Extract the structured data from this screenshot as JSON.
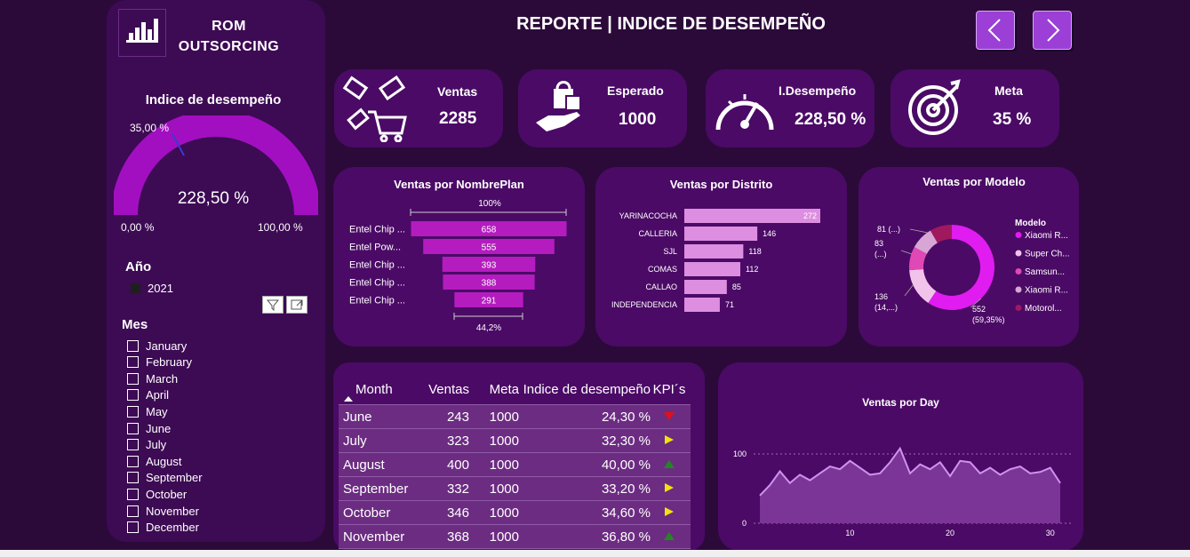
{
  "brand": {
    "line1": "ROM",
    "line2": "OUTSORCING"
  },
  "title": "REPORTE | INDICE DE DESEMPEÑO",
  "gauge": {
    "title": "Indice de desempeño",
    "value_label": "228,50 %",
    "min_label": "0,00 %",
    "max_label": "100,00 %",
    "target_label": "35,00 %",
    "fill_fraction": 1.0,
    "target_fraction": 0.35
  },
  "filters": {
    "year_title": "Año",
    "year_value": "2021",
    "month_title": "Mes",
    "months": [
      "January",
      "February",
      "March",
      "April",
      "May",
      "June",
      "July",
      "August",
      "September",
      "October",
      "November",
      "December"
    ]
  },
  "kpis": [
    {
      "label": "Ventas",
      "value": "2285",
      "icon": "sales-tags-cart-icon"
    },
    {
      "label": "Esperado",
      "value": "1000",
      "icon": "shopping-bag-hand-icon"
    },
    {
      "label": "I.Desempeño",
      "value": "228,50 %",
      "icon": "speedometer-icon"
    },
    {
      "label": "Meta",
      "value": "35 %",
      "icon": "target-icon"
    }
  ],
  "funnel": {
    "title": "Ventas por NombrePlan",
    "top_pct": "100%",
    "bottom_pct": "44,2%",
    "items": [
      {
        "label": "Entel Chip ...",
        "value": "658"
      },
      {
        "label": "Entel Pow...",
        "value": "555"
      },
      {
        "label": "Entel Chip ...",
        "value": "393"
      },
      {
        "label": "Entel Chip ...",
        "value": "388"
      },
      {
        "label": "Entel Chip ...",
        "value": "291"
      }
    ]
  },
  "district": {
    "title": "Ventas por Distrito",
    "items": [
      {
        "label": "YARINACOCHA",
        "value": "272"
      },
      {
        "label": "CALLERIA",
        "value": "146"
      },
      {
        "label": "SJL",
        "value": "118"
      },
      {
        "label": "COMAS",
        "value": "112"
      },
      {
        "label": "CALLAO",
        "value": "85"
      },
      {
        "label": "INDEPENDENCIA",
        "value": "71"
      }
    ]
  },
  "model": {
    "title": "Ventas por Modelo",
    "legend_title": "Modelo",
    "legend": [
      {
        "name": "Xiaomi R...",
        "color": "#e01cf0"
      },
      {
        "name": "Super Ch...",
        "color": "#f2c3ea"
      },
      {
        "name": "Samsun...",
        "color": "#e048b5"
      },
      {
        "name": "Xiaomi R...",
        "color": "#d8a6d4"
      },
      {
        "name": "Motorol...",
        "color": "#a0195e"
      }
    ],
    "labels": [
      {
        "text1": "552",
        "text2": "(59,35%)"
      },
      {
        "text1": "136",
        "text2": "(14,...)"
      },
      {
        "text1": "83",
        "text2": "(...)"
      },
      {
        "text1": "81 (...)",
        "text2": ""
      }
    ]
  },
  "table": {
    "headers": [
      "Month",
      "Ventas",
      "Meta",
      "Indice de desempeño",
      "KPI´s"
    ],
    "rows": [
      {
        "month": "June",
        "ventas": "243",
        "meta": "1000",
        "indice": "24,30 %",
        "kpi": "down",
        "kpi_color": "#e0101a"
      },
      {
        "month": "July",
        "ventas": "323",
        "meta": "1000",
        "indice": "32,30 %",
        "kpi": "right",
        "kpi_color": "#f2e20c"
      },
      {
        "month": "August",
        "ventas": "400",
        "meta": "1000",
        "indice": "40,00 %",
        "kpi": "up",
        "kpi_color": "#1e8a1e"
      },
      {
        "month": "September",
        "ventas": "332",
        "meta": "1000",
        "indice": "33,20 %",
        "kpi": "right",
        "kpi_color": "#f2e20c"
      },
      {
        "month": "October",
        "ventas": "346",
        "meta": "1000",
        "indice": "34,60 %",
        "kpi": "right",
        "kpi_color": "#f2e20c"
      },
      {
        "month": "November",
        "ventas": "368",
        "meta": "1000",
        "indice": "36,80 %",
        "kpi": "up",
        "kpi_color": "#1e8a1e"
      }
    ]
  },
  "chart_data": [
    {
      "type": "bar",
      "title": "Ventas por NombrePlan",
      "categories": [
        "Entel Chip ...",
        "Entel Pow...",
        "Entel Chip ...",
        "Entel Chip ...",
        "Entel Chip ..."
      ],
      "values": [
        658,
        555,
        393,
        388,
        291
      ]
    },
    {
      "type": "bar",
      "title": "Ventas por Distrito",
      "categories": [
        "YARINACOCHA",
        "CALLERIA",
        "SJL",
        "COMAS",
        "CALLAO",
        "INDEPENDENCIA"
      ],
      "values": [
        272,
        146,
        118,
        112,
        85,
        71
      ]
    },
    {
      "type": "pie",
      "title": "Ventas por Modelo",
      "categories": [
        "Xiaomi R...",
        "Super Ch...",
        "Samsun...",
        "Xiaomi R...",
        "Motorol..."
      ],
      "values": [
        552,
        136,
        83,
        81,
        78
      ]
    },
    {
      "type": "area",
      "title": "Ventas por Day",
      "x_ticks": [
        "10",
        "20",
        "30"
      ],
      "y_ticks": [
        "0",
        "100"
      ],
      "x": [
        1,
        2,
        3,
        4,
        5,
        6,
        7,
        8,
        9,
        10,
        11,
        12,
        13,
        14,
        15,
        16,
        17,
        18,
        19,
        20,
        21,
        22,
        23,
        24,
        25,
        26,
        27,
        28,
        29,
        30,
        31
      ],
      "values": [
        40,
        55,
        75,
        58,
        70,
        62,
        72,
        82,
        78,
        90,
        80,
        70,
        72,
        88,
        108,
        72,
        85,
        78,
        88,
        68,
        90,
        88,
        72,
        80,
        70,
        78,
        82,
        72,
        74,
        80,
        58
      ],
      "ylim": [
        0,
        110
      ]
    }
  ],
  "day_chart": {
    "title": "Ventas por Day",
    "line_color": "#d191ee",
    "fill_color": "#7b3596"
  }
}
